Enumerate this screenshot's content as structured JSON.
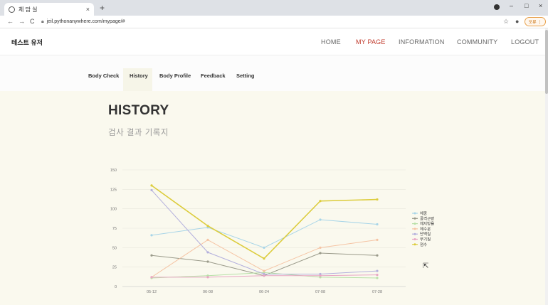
{
  "browser": {
    "tab_title": "체 맘 실",
    "tab_close": "×",
    "new_tab": "+",
    "url": "jeil.pythonanywhere.com/mypage/#",
    "pause_label": "오류 ⋮",
    "back": "←",
    "forward": "→",
    "reload": "C",
    "star": "☆",
    "profile": "●",
    "minimize": "–",
    "maximize": "□",
    "close": "×"
  },
  "header": {
    "brand": "테스트 유저",
    "nav": [
      "HOME",
      "MY PAGE",
      "INFORMATION",
      "COMMUNITY",
      "LOGOUT"
    ],
    "active_color": "#c0392b"
  },
  "subnav": {
    "items": [
      "Body Check",
      "History",
      "Body Profile",
      "Feedback",
      "Setting"
    ],
    "active": "History"
  },
  "page": {
    "title": "HISTORY",
    "subtitle": "검사 결과 기록지"
  },
  "chart_data": {
    "type": "line",
    "categories": [
      "05-12",
      "06-08",
      "06-24",
      "07-08",
      "07-28"
    ],
    "ylim": [
      0,
      150
    ],
    "yticks": [
      0,
      25,
      50,
      75,
      100,
      125,
      150
    ],
    "grid": true,
    "legend_position": "right",
    "series": [
      {
        "name": "체중",
        "color": "#a8d5e8",
        "values": [
          66,
          76,
          50,
          86,
          80
        ]
      },
      {
        "name": "골격근량",
        "color": "#9a9a8a",
        "values": [
          40,
          32,
          14,
          43,
          40
        ]
      },
      {
        "name": "체지방율",
        "color": "#b8e0a8",
        "values": [
          11,
          14,
          18,
          12,
          11
        ]
      },
      {
        "name": "체수분",
        "color": "#f5c4a4",
        "values": [
          12,
          60,
          20,
          50,
          60
        ]
      },
      {
        "name": "단백질",
        "color": "#b4b0dd",
        "values": [
          124,
          44,
          16,
          16,
          20
        ]
      },
      {
        "name": "무기질",
        "color": "#e8a6c4",
        "values": [
          12,
          12,
          14,
          14,
          15
        ]
      },
      {
        "name": "점수",
        "color": "#dccc3c",
        "values": [
          130,
          78,
          36,
          110,
          112
        ]
      }
    ]
  }
}
